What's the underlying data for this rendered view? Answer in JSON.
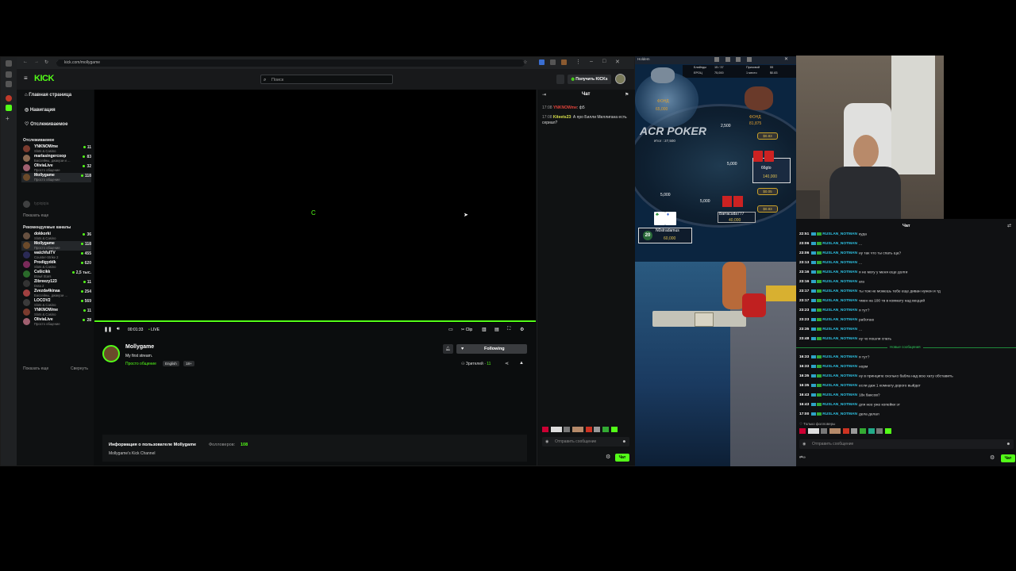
{
  "browser": {
    "url": "kick.com/mollygame"
  },
  "site": {
    "logo": "KICK",
    "search_placeholder": "Поиск",
    "get_kicks": "Получить KICKs"
  },
  "sidebar": {
    "menu": [
      "Главная страница",
      "Навигация",
      "Отслеживаемое"
    ],
    "followed_header": "Отслеживаемое",
    "followed": [
      {
        "name": "YNKNOWme",
        "cat": "Slots & Casino",
        "viewers": "11",
        "color": "#7a3b2e"
      },
      {
        "name": "marlasingercoop",
        "cat": "Бассейны, джакузи и ...",
        "viewers": "83",
        "color": "#8c6a52"
      },
      {
        "name": "OliviaLive",
        "cat": "Просто общение",
        "viewers": "32",
        "color": "#a06070"
      },
      {
        "name": "Mollygame",
        "cat": "Просто общение",
        "viewers": "118",
        "color": "#6b4a2a"
      }
    ],
    "offline": "typiqiqia",
    "show_more": "Показать еще",
    "recommended_header": "Рекомендуемые каналы",
    "recommended": [
      {
        "name": "dokkorki",
        "cat": "Slots & Casino",
        "viewers": "36",
        "color": "#665040"
      },
      {
        "name": "Mollygame",
        "cat": "Просто общение",
        "viewers": "118",
        "color": "#6b4a2a"
      },
      {
        "name": "watchfulTV",
        "cat": "Counter-Strike 2",
        "viewers": "455",
        "color": "#2a2a55"
      },
      {
        "name": "Prodigyddk",
        "cat": "Slots & Casino",
        "viewers": "620",
        "color": "#7a2a5a"
      },
      {
        "name": "Cs6icikk",
        "cat": "Brawl Stars",
        "viewers": "2,5 тыс.",
        "color": "#2a6a2a"
      },
      {
        "name": "Zibreezy123",
        "cat": "Dota 2",
        "viewers": "11",
        "color": "#333"
      },
      {
        "name": "Zvezda4kinaa",
        "cat": "Бассейны, джакузи ...",
        "viewers": "254",
        "color": "#a04040"
      },
      {
        "name": "LOCOV2",
        "cat": "Slots & Casino",
        "viewers": "569",
        "color": "#3a3a3a"
      },
      {
        "name": "YNKNOWme",
        "cat": "Slots & Casino",
        "viewers": "11",
        "color": "#7a3b2e"
      },
      {
        "name": "OliviaLive",
        "cat": "Просто общение",
        "viewers": "28",
        "color": "#a06070"
      }
    ],
    "footer_more": "Показать еще",
    "footer_collapse": "Свернуть"
  },
  "player": {
    "time": "00:01:33",
    "live": "LIVE",
    "clip": "Clip",
    "loading": "C"
  },
  "stream": {
    "name": "Mollygame",
    "title": "My first stream.",
    "category": "Просто общение",
    "tags": [
      "English",
      "18+"
    ],
    "following": "Following",
    "viewers_label": "Зрителей",
    "viewers": "11"
  },
  "about": {
    "heading": "Информация о пользователе Mollygame",
    "followers_label": "Фолловеров:",
    "followers": "108",
    "bio": "Mollygame's Kick Channel"
  },
  "kick_chat": {
    "title": "Чат",
    "messages": [
      {
        "time": "17:08",
        "user": "YNKNOWme",
        "user_color": "#e0433a",
        "text": "ф5"
      },
      {
        "time": "17:08",
        "user": "Kiteets23",
        "user_color": "#d9e04a",
        "text": "А про Билли Миллигана есть сериал?"
      }
    ],
    "input_placeholder": "Отправить сообщение",
    "send": "Чат"
  },
  "poker": {
    "title": "Holdem",
    "hud": [
      {
        "label": "Блайнды",
        "value": "15 / 37"
      },
      {
        "label": "Призовой",
        "value": "55"
      },
      {
        "label": "ЕРОЦ",
        "value": "75,000"
      },
      {
        "label": "1 место",
        "value": "$0.83"
      }
    ],
    "logo": "ACR POKER",
    "pot_label": "Итог : 27,500",
    "pot": "2,500",
    "pot2": "5,000",
    "bet_left": "5,000",
    "bet_center": "5,000",
    "opp_top": {
      "name": "ФОНД",
      "stack": "65,000"
    },
    "opp_right_top": {
      "name": "ФОНД",
      "stack": "81,875"
    },
    "p66": {
      "name": "66gto",
      "stack": "140,000",
      "val1": "$0.83",
      "val2": "$0.05"
    },
    "barracuda": {
      "name": "Barracuda777",
      "stack": "40,000",
      "val": "$0.83"
    },
    "hero": {
      "name": "N0stradamus",
      "stack": "60,000",
      "level": "20"
    },
    "chip_right": "$0.83"
  },
  "twitch_chat": {
    "title": "Чат",
    "messages": [
      {
        "time": "22:51",
        "user": "RUSLAN_NOTMAN",
        "text": "куда"
      },
      {
        "time": "23:06",
        "user": "RUSLAN_NOTMAN",
        "text": "..."
      },
      {
        "time": "23:06",
        "user": "RUSLAN_NOTMAN",
        "text": "ну так что ты спать ща?"
      },
      {
        "time": "23:13",
        "user": "RUSLAN_NOTMAN",
        "text": "..."
      },
      {
        "time": "23:16",
        "user": "RUSLAN_NOTMAN",
        "text": "я не могу у меня еще долги"
      },
      {
        "time": "23:16",
        "user": "RUSLAN_NOTMAN",
        "text": "ага"
      },
      {
        "time": "23:17",
        "user": "RUSLAN_NOTMAN",
        "text": "ты тож не можешь тебе еще диван нужен и тд"
      },
      {
        "time": "23:17",
        "user": "RUSLAN_NOTMAN",
        "text": "чмен на 100 тв в комнату над веццей"
      },
      {
        "time": "23:23",
        "user": "RUSLAN_NOTMAN",
        "text": "я тут?"
      },
      {
        "time": "23:23",
        "user": "RUSLAN_NOTMAN",
        "text": "работаю"
      },
      {
        "time": "23:35",
        "user": "RUSLAN_NOTMAN",
        "text": "..."
      },
      {
        "time": "23:48",
        "user": "RUSLAN_NOTMAN",
        "text": "ну чо пошли спать"
      }
    ],
    "new_messages": "Новые сообщения",
    "messages2": [
      {
        "time": "16:33",
        "user": "RUSLAN_NOTMAN",
        "text": "я тут?"
      },
      {
        "time": "16:33",
        "user": "RUSLAN_NOTMAN",
        "text": "норм"
      },
      {
        "time": "16:35",
        "user": "RUSLAN_NOTMAN",
        "text": "ну в принципе сколько бабла над всю хату обставить"
      },
      {
        "time": "16:35",
        "user": "RUSLAN_NOTMAN",
        "text": "если даж 1 комнату дорого выйдет"
      },
      {
        "time": "16:43",
        "user": "RUSLAN_NOTMAN",
        "text": "18к баксов?"
      },
      {
        "time": "16:43",
        "user": "RUSLAN_NOTMAN",
        "text": "для нее уже копейки эт"
      },
      {
        "time": "17:00",
        "user": "RUSLAN_NOTMAN",
        "text": "дела делал"
      }
    ],
    "followers_only": "Только фолловеры",
    "input_placeholder": "Отправить сообщение",
    "send": "Чат"
  },
  "accent": "#53fc18"
}
